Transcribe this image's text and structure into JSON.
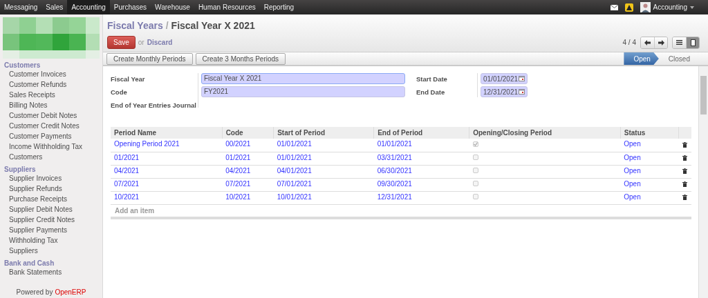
{
  "top_menu": [
    {
      "label": "Messaging",
      "selected": false
    },
    {
      "label": "Sales",
      "selected": false
    },
    {
      "label": "Accounting",
      "selected": true
    },
    {
      "label": "Purchases",
      "selected": false
    },
    {
      "label": "Warehouse",
      "selected": false
    },
    {
      "label": "Human Resources",
      "selected": false
    },
    {
      "label": "Reporting",
      "selected": false
    }
  ],
  "user": {
    "name": "Accounting"
  },
  "sidebar": {
    "sections": [
      {
        "title": "Customers",
        "items": [
          "Customer Invoices",
          "Customer Refunds",
          "Sales Receipts",
          "Billing Notes",
          "Customer Debit Notes",
          "Customer Credit Notes",
          "Customer Payments",
          "Income Withholding Tax",
          "Customers"
        ]
      },
      {
        "title": "Suppliers",
        "items": [
          "Supplier Invoices",
          "Supplier Refunds",
          "Purchase Receipts",
          "Supplier Debit Notes",
          "Supplier Credit Notes",
          "Supplier Payments",
          "Withholding Tax",
          "Suppliers"
        ]
      },
      {
        "title": "Bank and Cash",
        "items": [
          "Bank Statements"
        ]
      }
    ],
    "footer": {
      "prefix": "Powered by",
      "brand": "OpenERP"
    }
  },
  "breadcrumb": {
    "parent": "Fiscal Years",
    "separator": "/",
    "current": "Fiscal Year X 2021"
  },
  "actions": {
    "save": "Save",
    "or": "or",
    "discard": "Discard"
  },
  "pager": "4 / 4",
  "views": [
    {
      "kind": "list",
      "selected": false
    },
    {
      "kind": "form",
      "selected": true
    }
  ],
  "buttons": [
    "Create Monthly Periods",
    "Create 3 Months Periods"
  ],
  "stages": [
    {
      "label": "Open",
      "selected": true
    },
    {
      "label": "Closed",
      "selected": false
    }
  ],
  "form": {
    "left": [
      {
        "label": "Fiscal Year",
        "value": "Fiscal Year X 2021"
      },
      {
        "label": "Code",
        "value": "FY2021"
      },
      {
        "label": "End of Year Entries Journal"
      }
    ],
    "right": [
      {
        "label": "Start Date",
        "value": "01/01/2021"
      },
      {
        "label": "End Date",
        "value": "12/31/2021"
      }
    ]
  },
  "table": {
    "columns": [
      "Period Name",
      "Code",
      "Start of Period",
      "End of Period",
      "Opening/Closing Period",
      "Status"
    ],
    "rows": [
      {
        "name": "Opening Period 2021",
        "code": "00/2021",
        "start": "01/01/2021",
        "end": "01/01/2021",
        "checked": true,
        "status": "Open"
      },
      {
        "name": "01/2021",
        "code": "01/2021",
        "start": "01/01/2021",
        "end": "03/31/2021",
        "checked": false,
        "status": "Open"
      },
      {
        "name": "04/2021",
        "code": "04/2021",
        "start": "04/01/2021",
        "end": "06/30/2021",
        "checked": false,
        "status": "Open"
      },
      {
        "name": "07/2021",
        "code": "07/2021",
        "start": "07/01/2021",
        "end": "09/30/2021",
        "checked": false,
        "status": "Open"
      },
      {
        "name": "10/2021",
        "code": "10/2021",
        "start": "10/01/2021",
        "end": "12/31/2021",
        "checked": false,
        "status": "Open"
      }
    ],
    "add_item": "Add an item"
  }
}
